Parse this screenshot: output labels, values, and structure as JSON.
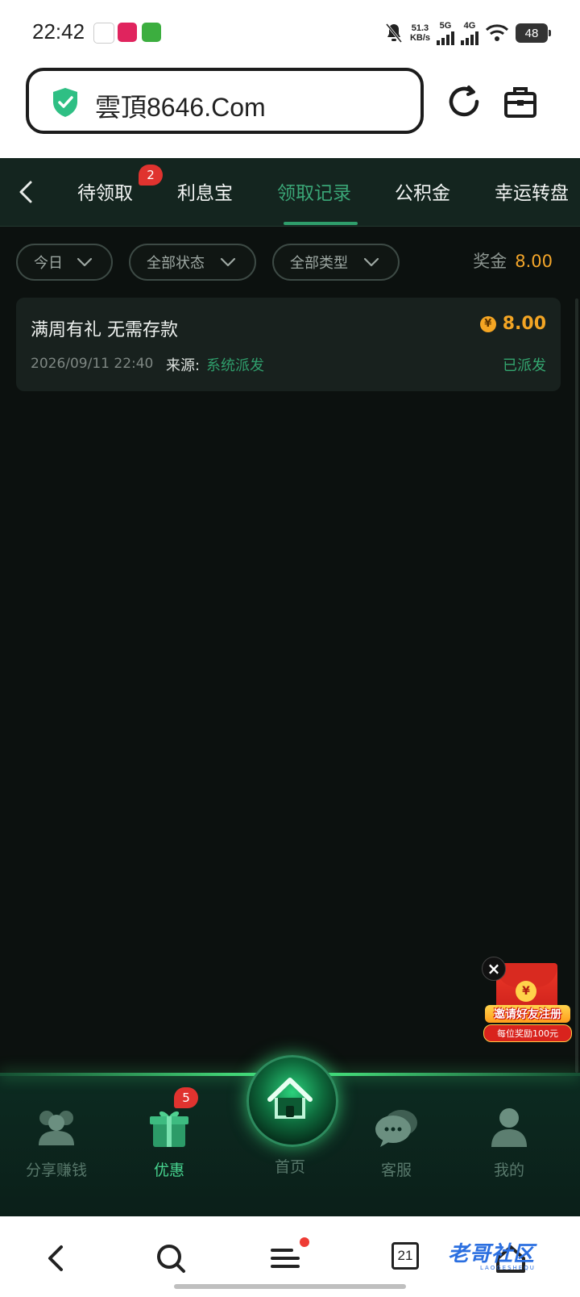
{
  "status_bar": {
    "time": "22:42",
    "net_speed": "51.3",
    "net_unit": "KB/s",
    "sig1": "5G",
    "sig2": "4G",
    "battery": "48"
  },
  "browser": {
    "url": "雲頂8646.Com",
    "icons": [
      "shield-check-icon",
      "refresh-icon",
      "toolbox-icon"
    ]
  },
  "tabs": [
    {
      "label": "待领取",
      "badge": "2"
    },
    {
      "label": "利息宝"
    },
    {
      "label": "领取记录",
      "active": true
    },
    {
      "label": "公积金"
    },
    {
      "label": "幸运转盘"
    }
  ],
  "filters": {
    "date": "今日",
    "status": "全部状态",
    "type": "全部类型"
  },
  "bonus": {
    "label": "奖金",
    "amount": "8.00"
  },
  "records": [
    {
      "title": "满周有礼 无需存款",
      "amount": "8.00",
      "coin_symbol": "¥",
      "datetime": "2026/09/11 22:40",
      "source_label": "来源:",
      "source": "系统派发",
      "status": "已派发"
    }
  ],
  "promo": {
    "close": "×",
    "coin_symbol": "¥",
    "line1": "邀请好友注册",
    "line2": "每位奖励100元"
  },
  "bottom_nav": [
    {
      "label": "分享赚钱",
      "icon": "share-people-icon"
    },
    {
      "label": "优惠",
      "icon": "gift-icon",
      "badge": "5",
      "active": true
    },
    {
      "label": "首页",
      "icon": "home-icon"
    },
    {
      "label": "客服",
      "icon": "chat-icon"
    },
    {
      "label": "我的",
      "icon": "user-icon"
    }
  ],
  "browser_toolbar": {
    "tab_count": "21",
    "watermark": "老哥社区",
    "watermark_sub": "LAOGESHEQU"
  },
  "colors": {
    "accent_green": "#2f9e6b",
    "amount_orange": "#f4a62a",
    "badge_red": "#e0332f",
    "background": "#0c110f"
  }
}
